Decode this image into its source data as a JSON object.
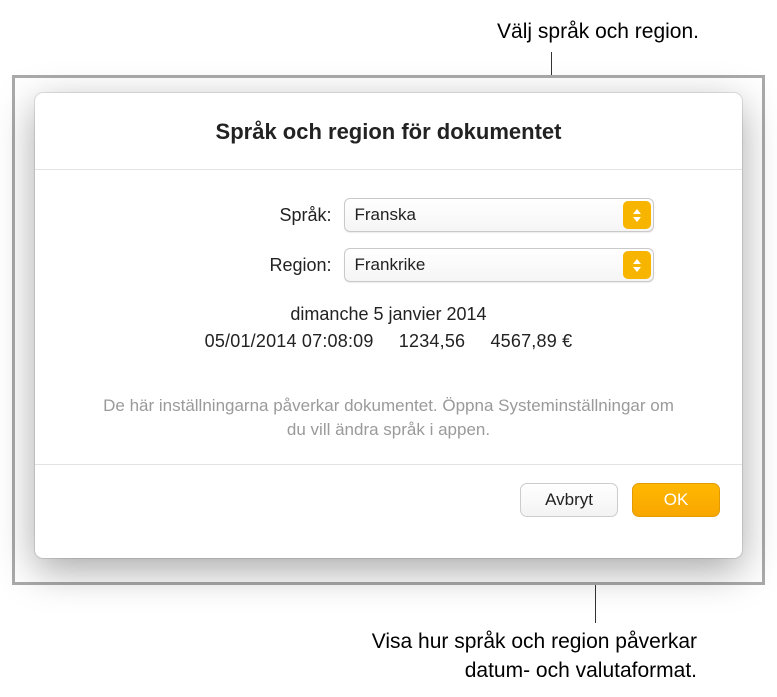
{
  "callouts": {
    "top": "Välj språk och region.",
    "bottom_line1": "Visa hur språk och region påverkar",
    "bottom_line2": "datum- och valutaformat."
  },
  "dialog": {
    "title": "Språk och region för dokumentet",
    "language_label": "Språk:",
    "language_value": "Franska",
    "region_label": "Region:",
    "region_value": "Frankrike",
    "preview": {
      "long_date": "dimanche 5 janvier 2014",
      "short": "05/01/2014 07:08:09",
      "number": "1234,56",
      "currency": "4567,89 €"
    },
    "help_text": "De här inställningarna påverkar dokumentet. Öppna Systeminställningar om du vill ändra språk i appen.",
    "cancel_label": "Avbryt",
    "ok_label": "OK"
  },
  "colors": {
    "accent": "#f8b500"
  }
}
